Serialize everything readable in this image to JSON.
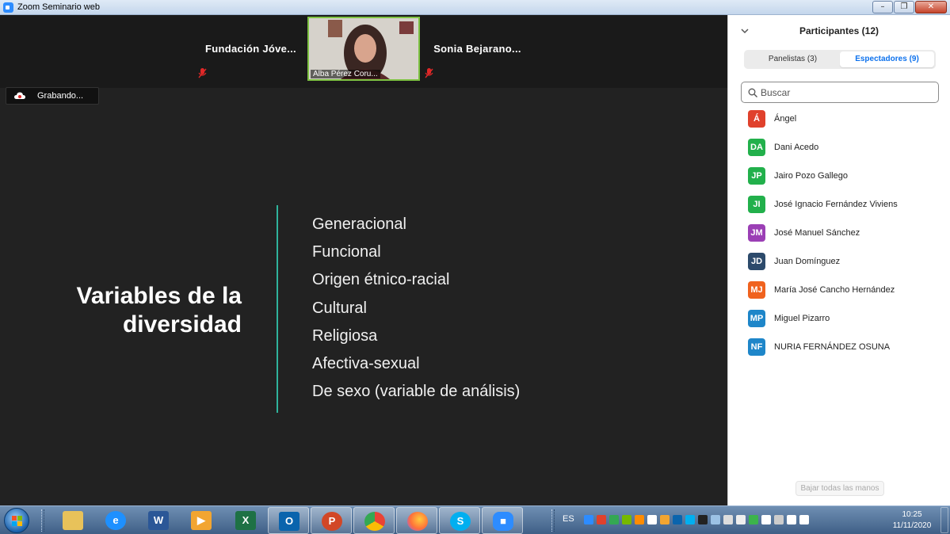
{
  "window": {
    "title": "Zoom Seminario web",
    "controls": [
      "–",
      "❐",
      "✕"
    ]
  },
  "video_strip": {
    "tiles": [
      {
        "name": "Fundación  Jóve..."
      },
      {
        "name": "Alba Pérez Coru..."
      },
      {
        "name": "Sonia  Bejarano..."
      }
    ]
  },
  "recording": {
    "label": "Grabando..."
  },
  "slide": {
    "title": "Variables de la diversidad",
    "items": [
      "Generacional",
      "Funcional",
      "Origen étnico-racial",
      "Cultural",
      "Religiosa",
      "Afectiva-sexual",
      "De sexo (variable de análisis)"
    ],
    "accent_color": "#2fb39c"
  },
  "participants_panel": {
    "title": "Participantes (12)",
    "tabs": [
      {
        "label": "Panelistas (3)",
        "selected": false
      },
      {
        "label": "Espectadores (9)",
        "selected": true
      }
    ],
    "search_placeholder": "Buscar",
    "participants": [
      {
        "initials": "Á",
        "name": "Ángel",
        "color": "#e0412c"
      },
      {
        "initials": "DA",
        "name": "Dani Acedo",
        "color": "#22b04b"
      },
      {
        "initials": "JP",
        "name": "Jairo Pozo Gallego",
        "color": "#22b04b"
      },
      {
        "initials": "JI",
        "name": "José Ignacio Fernández Viviens",
        "color": "#22b04b"
      },
      {
        "initials": "JM",
        "name": "José Manuel Sánchez",
        "color": "#9b3fb5"
      },
      {
        "initials": "JD",
        "name": "Juan Domínguez",
        "color": "#2c4a6b"
      },
      {
        "initials": "MJ",
        "name": "María José Cancho Hernández",
        "color": "#f0621e"
      },
      {
        "initials": "MP",
        "name": "Miguel Pizarro",
        "color": "#1e86c9"
      },
      {
        "initials": "NF",
        "name": "NURIA FERNÁNDEZ OSUNA",
        "color": "#1e86c9"
      }
    ],
    "lower_all_hands": "Bajar todas las manos"
  },
  "taskbar": {
    "apps": [
      {
        "icon": "file-explorer-icon",
        "glyph": "",
        "color": "#e8c25a"
      },
      {
        "icon": "internet-explorer-icon",
        "glyph": "e",
        "color": "#1e90ff"
      },
      {
        "icon": "word-icon",
        "glyph": "W",
        "color": "#2b5797"
      },
      {
        "icon": "media-player-icon",
        "glyph": "▶",
        "color": "#f2a531"
      },
      {
        "icon": "excel-icon",
        "glyph": "X",
        "color": "#1e7145"
      },
      {
        "icon": "outlook-icon",
        "glyph": "O",
        "color": "#0a64ad"
      },
      {
        "icon": "powerpoint-icon",
        "glyph": "P",
        "color": "#d24726"
      },
      {
        "icon": "chrome-icon",
        "glyph": "",
        "color": "#34a853"
      },
      {
        "icon": "firefox-icon",
        "glyph": "",
        "color": "#ff7139"
      },
      {
        "icon": "skype-icon",
        "glyph": "S",
        "color": "#00aff0"
      },
      {
        "icon": "zoom-icon",
        "glyph": "■",
        "color": "#2d8cff"
      }
    ],
    "language": "ES",
    "time": "10:25",
    "date": "11/11/2020"
  }
}
